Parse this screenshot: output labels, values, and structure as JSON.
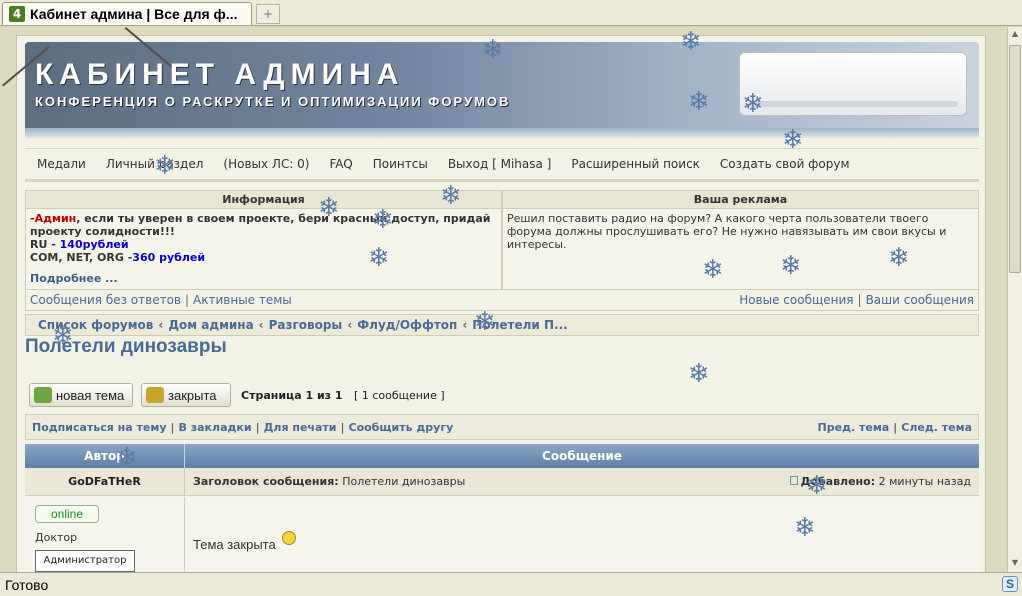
{
  "browser": {
    "tab_title": "Кабинет админа | Все для ф...",
    "tab_icon": "4",
    "new_tab": "+",
    "status": "Готово",
    "status_icon": "S"
  },
  "banner": {
    "title": "КАБИНЕТ  АДМИНА",
    "subtitle": "КОНФЕРЕНЦИЯ О РАСКРУТКЕ И ОПТИМИЗАЦИИ ФОРУМОВ"
  },
  "nav": {
    "items": [
      "Медали",
      "Личный раздел",
      "(Новых ЛС: 0)",
      "FAQ",
      "Поинтсы",
      "Выход [ Mihasa ]",
      "Расширенный поиск",
      "Создать свой форум"
    ]
  },
  "info": {
    "left_title": "Информация",
    "admin_word": "-Админ",
    "line1": ", если ты уверен в своем проекте, бери красный доступ, придай проекту солидности!!!",
    "ru_label": "RU - ",
    "ru_price": "140рублей",
    "com_label": "COM, NET, ORG -",
    "com_price": "360 рублей",
    "more": "Подробнее ...",
    "right_title": "Ваша реклама",
    "right_text": "Решил поставить радио на форум? А какого черта пользователи твоего форума должны прослушивать его? Не нужно навязывать им свои вкусы и интересы."
  },
  "quick": {
    "unanswered": "Сообщения без ответов",
    "active": "Активные темы",
    "new_posts": "Новые сообщения",
    "your_posts": "Ваши сообщения"
  },
  "breadcrumb": [
    "Список форумов",
    "Дом админа",
    "Разговоры",
    "Флуд/Оффтоп",
    "Полетели П..."
  ],
  "topic": {
    "title": "Полетели динозавры",
    "btn_new": "новая тема",
    "btn_locked": "закрыта",
    "page": "Страница 1 из 1",
    "count": "[ 1 сообщение ]"
  },
  "actions": {
    "subscribe": "Подписаться на тему",
    "bookmark": "В закладки",
    "print": "Для печати",
    "tell": "Сообщить другу",
    "prev": "Пред. тема",
    "next": "След. тема"
  },
  "post": {
    "col_author": "Автор",
    "col_message": "Сообщение",
    "author": "GoDFaTHeR",
    "subject_label": "Заголовок сообщения:",
    "subject": "Полетели динозавры",
    "added_label": "Добавлено:",
    "added": "2 минуты назад",
    "status": "online",
    "rank": "Доктор",
    "badge": "Администратор",
    "body": "Тема закрыта"
  }
}
